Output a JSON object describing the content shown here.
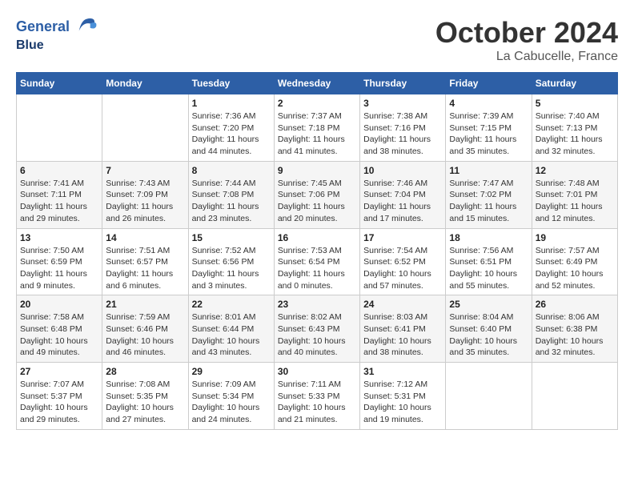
{
  "header": {
    "logo_line1": "General",
    "logo_line2": "Blue",
    "month": "October 2024",
    "location": "La Cabucelle, France"
  },
  "weekdays": [
    "Sunday",
    "Monday",
    "Tuesday",
    "Wednesday",
    "Thursday",
    "Friday",
    "Saturday"
  ],
  "weeks": [
    [
      {
        "day": "",
        "info": ""
      },
      {
        "day": "",
        "info": ""
      },
      {
        "day": "1",
        "info": "Sunrise: 7:36 AM\nSunset: 7:20 PM\nDaylight: 11 hours and 44 minutes."
      },
      {
        "day": "2",
        "info": "Sunrise: 7:37 AM\nSunset: 7:18 PM\nDaylight: 11 hours and 41 minutes."
      },
      {
        "day": "3",
        "info": "Sunrise: 7:38 AM\nSunset: 7:16 PM\nDaylight: 11 hours and 38 minutes."
      },
      {
        "day": "4",
        "info": "Sunrise: 7:39 AM\nSunset: 7:15 PM\nDaylight: 11 hours and 35 minutes."
      },
      {
        "day": "5",
        "info": "Sunrise: 7:40 AM\nSunset: 7:13 PM\nDaylight: 11 hours and 32 minutes."
      }
    ],
    [
      {
        "day": "6",
        "info": "Sunrise: 7:41 AM\nSunset: 7:11 PM\nDaylight: 11 hours and 29 minutes."
      },
      {
        "day": "7",
        "info": "Sunrise: 7:43 AM\nSunset: 7:09 PM\nDaylight: 11 hours and 26 minutes."
      },
      {
        "day": "8",
        "info": "Sunrise: 7:44 AM\nSunset: 7:08 PM\nDaylight: 11 hours and 23 minutes."
      },
      {
        "day": "9",
        "info": "Sunrise: 7:45 AM\nSunset: 7:06 PM\nDaylight: 11 hours and 20 minutes."
      },
      {
        "day": "10",
        "info": "Sunrise: 7:46 AM\nSunset: 7:04 PM\nDaylight: 11 hours and 17 minutes."
      },
      {
        "day": "11",
        "info": "Sunrise: 7:47 AM\nSunset: 7:02 PM\nDaylight: 11 hours and 15 minutes."
      },
      {
        "day": "12",
        "info": "Sunrise: 7:48 AM\nSunset: 7:01 PM\nDaylight: 11 hours and 12 minutes."
      }
    ],
    [
      {
        "day": "13",
        "info": "Sunrise: 7:50 AM\nSunset: 6:59 PM\nDaylight: 11 hours and 9 minutes."
      },
      {
        "day": "14",
        "info": "Sunrise: 7:51 AM\nSunset: 6:57 PM\nDaylight: 11 hours and 6 minutes."
      },
      {
        "day": "15",
        "info": "Sunrise: 7:52 AM\nSunset: 6:56 PM\nDaylight: 11 hours and 3 minutes."
      },
      {
        "day": "16",
        "info": "Sunrise: 7:53 AM\nSunset: 6:54 PM\nDaylight: 11 hours and 0 minutes."
      },
      {
        "day": "17",
        "info": "Sunrise: 7:54 AM\nSunset: 6:52 PM\nDaylight: 10 hours and 57 minutes."
      },
      {
        "day": "18",
        "info": "Sunrise: 7:56 AM\nSunset: 6:51 PM\nDaylight: 10 hours and 55 minutes."
      },
      {
        "day": "19",
        "info": "Sunrise: 7:57 AM\nSunset: 6:49 PM\nDaylight: 10 hours and 52 minutes."
      }
    ],
    [
      {
        "day": "20",
        "info": "Sunrise: 7:58 AM\nSunset: 6:48 PM\nDaylight: 10 hours and 49 minutes."
      },
      {
        "day": "21",
        "info": "Sunrise: 7:59 AM\nSunset: 6:46 PM\nDaylight: 10 hours and 46 minutes."
      },
      {
        "day": "22",
        "info": "Sunrise: 8:01 AM\nSunset: 6:44 PM\nDaylight: 10 hours and 43 minutes."
      },
      {
        "day": "23",
        "info": "Sunrise: 8:02 AM\nSunset: 6:43 PM\nDaylight: 10 hours and 40 minutes."
      },
      {
        "day": "24",
        "info": "Sunrise: 8:03 AM\nSunset: 6:41 PM\nDaylight: 10 hours and 38 minutes."
      },
      {
        "day": "25",
        "info": "Sunrise: 8:04 AM\nSunset: 6:40 PM\nDaylight: 10 hours and 35 minutes."
      },
      {
        "day": "26",
        "info": "Sunrise: 8:06 AM\nSunset: 6:38 PM\nDaylight: 10 hours and 32 minutes."
      }
    ],
    [
      {
        "day": "27",
        "info": "Sunrise: 7:07 AM\nSunset: 5:37 PM\nDaylight: 10 hours and 29 minutes."
      },
      {
        "day": "28",
        "info": "Sunrise: 7:08 AM\nSunset: 5:35 PM\nDaylight: 10 hours and 27 minutes."
      },
      {
        "day": "29",
        "info": "Sunrise: 7:09 AM\nSunset: 5:34 PM\nDaylight: 10 hours and 24 minutes."
      },
      {
        "day": "30",
        "info": "Sunrise: 7:11 AM\nSunset: 5:33 PM\nDaylight: 10 hours and 21 minutes."
      },
      {
        "day": "31",
        "info": "Sunrise: 7:12 AM\nSunset: 5:31 PM\nDaylight: 10 hours and 19 minutes."
      },
      {
        "day": "",
        "info": ""
      },
      {
        "day": "",
        "info": ""
      }
    ]
  ]
}
